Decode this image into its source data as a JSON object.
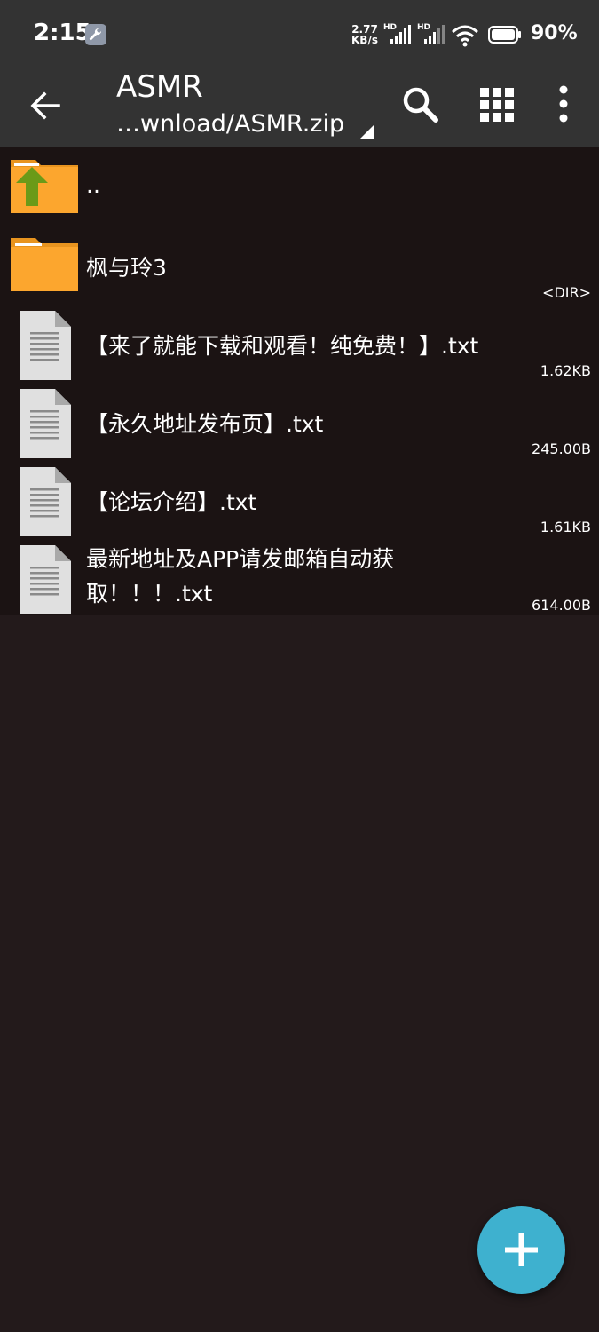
{
  "status_bar": {
    "time": "2:15",
    "network_speed": "2.77",
    "network_speed_unit": "KB/s",
    "sim1_label": "HD",
    "sim2_label": "HD",
    "battery_percent": "90%",
    "icons": [
      "wrench-icon",
      "signal-icon",
      "wifi-icon",
      "battery-icon"
    ]
  },
  "toolbar": {
    "title": "ASMR",
    "path": "…wnload/ASMR.zip",
    "icons": [
      "back-arrow-icon",
      "search-icon",
      "grid-view-icon",
      "more-vert-icon",
      "dropdown-triangle-icon"
    ]
  },
  "files": [
    {
      "type": "parent",
      "icon": "folder-up-icon",
      "name": "..",
      "meta": ""
    },
    {
      "type": "folder",
      "icon": "folder-icon",
      "name": "枫与玲3",
      "meta": "<DIR>"
    },
    {
      "type": "file",
      "icon": "text-file-icon",
      "name": "【来了就能下载和观看！纯免费！】.txt",
      "meta": "1.62KB"
    },
    {
      "type": "file",
      "icon": "text-file-icon",
      "name": "【永久地址发布页】.txt",
      "meta": "245.00B"
    },
    {
      "type": "file",
      "icon": "text-file-icon",
      "name": "【论坛介绍】.txt",
      "meta": "1.61KB"
    },
    {
      "type": "file",
      "icon": "text-file-icon",
      "name": "最新地址及APP请发邮箱自动获取！！！.txt",
      "meta": "614.00B"
    }
  ],
  "fab": {
    "icon": "plus-icon"
  },
  "colors": {
    "toolbar_bg": "#333333",
    "list_bg": "#1b1313",
    "screen_bg": "#231a1b",
    "folder": "#fca62e",
    "up_arrow": "#6b9a18",
    "fab": "#3eb1cf"
  }
}
